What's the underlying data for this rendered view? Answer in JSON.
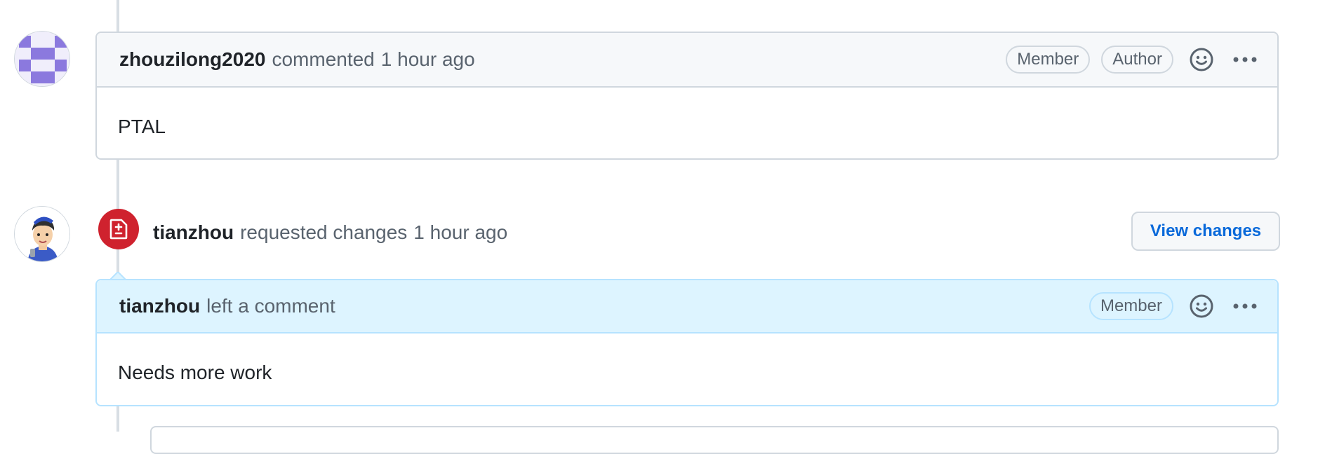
{
  "comment1": {
    "author": "zhouzilong2020",
    "action": "commented",
    "time": "1 hour ago",
    "badges": [
      "Member",
      "Author"
    ],
    "body": "PTAL"
  },
  "review": {
    "author": "tianzhou",
    "action": "requested changes",
    "time": "1 hour ago",
    "view_button": "View changes"
  },
  "comment2": {
    "author": "tianzhou",
    "action": "left a comment",
    "badge": "Member",
    "body": "Needs more work"
  },
  "icons": {
    "reaction": "smiley-icon",
    "more": "kebab-horizontal-icon",
    "review": "file-diff-icon"
  },
  "colors": {
    "header_bg": "#f6f8fa",
    "border": "#d0d7de",
    "review_header_bg": "#ddf4ff",
    "review_border": "#b6e3ff",
    "link": "#0969da",
    "danger": "#cf222e",
    "avatar_pattern": "#8b79de"
  }
}
